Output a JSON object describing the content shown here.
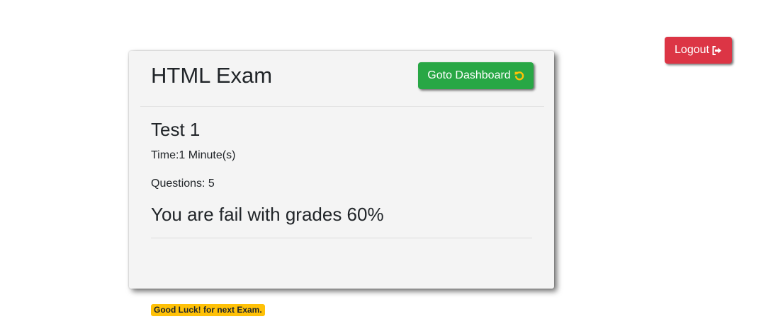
{
  "header": {
    "logout_label": "Logout"
  },
  "card": {
    "exam_title": "HTML Exam",
    "dashboard_label": "Goto Dashboard",
    "test_name": "Test 1",
    "time_text": "Time:1 Minute(s)",
    "questions_text": "Questions: 5",
    "result_text": "You are fail with grades 60%",
    "badge_text": "Good Luck! for next Exam."
  },
  "icons": {
    "logout": "sign-out-icon",
    "dashboard": "refresh-icon"
  },
  "colors": {
    "logout_button": "#dc3545",
    "dashboard_button": "#28a745",
    "refresh_icon": "#ffc107",
    "badge": "#ffc107",
    "card_background": "#f4f4f4"
  }
}
